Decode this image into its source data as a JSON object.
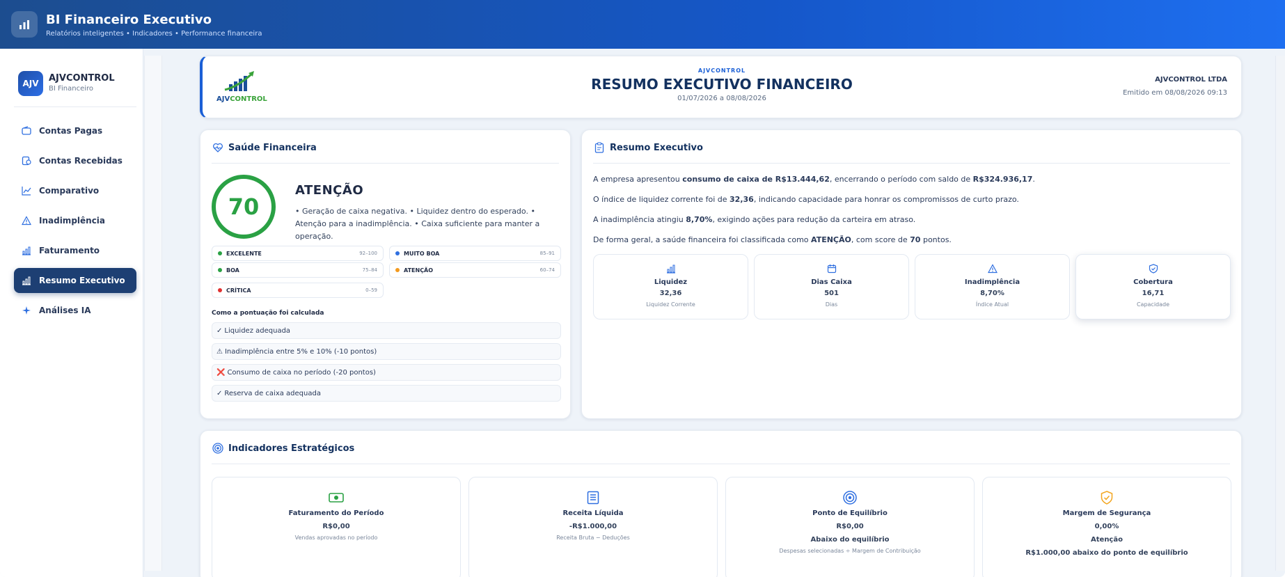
{
  "app": {
    "title": "BI Financeiro Executivo",
    "subtitle": "Relatórios inteligentes • Indicadores • Performance financeira"
  },
  "sidebar": {
    "brand_initials": "AJV",
    "brand_name": "AJVCONTROL",
    "brand_sub": "BI Financeiro",
    "items": [
      {
        "label": "Contas Pagas",
        "icon": "wallet-icon"
      },
      {
        "label": "Contas Recebidas",
        "icon": "receipt-icon"
      },
      {
        "label": "Comparativo",
        "icon": "trend-icon"
      },
      {
        "label": "Inadimplência",
        "icon": "warning-icon"
      },
      {
        "label": "Faturamento",
        "icon": "bar-chart-icon"
      },
      {
        "label": "Resumo Executivo",
        "icon": "bar-chart-icon",
        "active": true
      },
      {
        "label": "Análises IA",
        "icon": "sparkle-icon"
      }
    ]
  },
  "report": {
    "logo_text_a": "AJV",
    "logo_text_b": "CONTROL",
    "brand": "AJVCONTROL",
    "title": "RESUMO EXECUTIVO FINANCEIRO",
    "period": "01/07/2026 a 08/08/2026",
    "company": "AJVCONTROL LTDA",
    "issued": "Emitido em 08/08/2026 09:13"
  },
  "health": {
    "title": "Saúde Financeira",
    "score": "70",
    "status": "ATENÇÃO",
    "description": "• Geração de caixa negativa. • Liquidez dentro do esperado. • Atenção para a inadimplência. • Caixa suficiente para manter a operação.",
    "legend": [
      {
        "label": "EXCELENTE",
        "range": "92–100",
        "color": "#2aa144"
      },
      {
        "label": "MUITO BOA",
        "range": "85–91",
        "color": "#2f6fe0"
      },
      {
        "label": "BOA",
        "range": "75–84",
        "color": "#2aa144"
      },
      {
        "label": "ATENÇÃO",
        "range": "60–74",
        "color": "#f39a1e"
      },
      {
        "label": "CRÍTICA",
        "range": "0–59",
        "color": "#e03131"
      }
    ],
    "calc_title": "Como a pontuação foi calculada",
    "calc_items": [
      {
        "symbol": "✓",
        "text": "Liquidez adequada"
      },
      {
        "symbol": "⚠",
        "text": "Inadimplência entre 5% e 10% (-10 pontos)"
      },
      {
        "symbol": "❌",
        "text": "Consumo de caixa no período (-20 pontos)"
      },
      {
        "symbol": "✓",
        "text": "Reserva de caixa adequada"
      }
    ]
  },
  "exec": {
    "title": "Resumo Executivo",
    "p1a": "A empresa apresentou ",
    "p1b": "consumo de caixa de R$13.444,62",
    "p1c": ", encerrando o período com saldo de ",
    "p1d": "R$324.936,17",
    "p1e": ".",
    "p2a": "O índice de liquidez corrente foi de ",
    "p2b": "32,36",
    "p2c": ", indicando capacidade para honrar os compromissos de curto prazo.",
    "p3a": "A inadimplência atingiu ",
    "p3b": "8,70%",
    "p3c": ", exigindo ações para redução da carteira em atraso.",
    "p4a": "De forma geral, a saúde financeira foi classificada como ",
    "p4b": "ATENÇÃO",
    "p4c": ", com score de ",
    "p4d": "70",
    "p4e": " pontos.",
    "kpis": [
      {
        "label": "Liquidez",
        "value": "32,36",
        "sub": "Liquidez Corrente",
        "icon": "bar-chart-icon"
      },
      {
        "label": "Dias Caixa",
        "value": "501",
        "sub": "Dias",
        "icon": "calendar-icon"
      },
      {
        "label": "Inadimplência",
        "value": "8,70%",
        "sub": "Índice Atual",
        "icon": "warning-icon"
      },
      {
        "label": "Cobertura",
        "value": "16,71",
        "sub": "Capacidade",
        "icon": "shield-icon"
      }
    ]
  },
  "strategic": {
    "title": "Indicadores Estratégicos",
    "cards": [
      {
        "label": "Faturamento do Período",
        "value": "R$0,00",
        "sub": "Vendas aprovadas no período",
        "icon": "money-icon"
      },
      {
        "label": "Receita Líquida",
        "value": "-R$1.000,00",
        "sub": "Receita Bruta − Deduções",
        "icon": "document-icon"
      },
      {
        "label": "Ponto de Equilíbrio",
        "value": "R$0,00",
        "extra": "Abaixo do equilíbrio",
        "sub": "Despesas selecionadas ÷ Margem de Contribuição",
        "icon": "target-icon"
      },
      {
        "label": "Margem de Segurança",
        "value": "0,00%",
        "extra": "Atenção",
        "extra2": "R$1.000,00 abaixo do ponto de equilíbrio",
        "icon": "shield-check-icon"
      }
    ]
  },
  "colors": {
    "header_start": "#1c4d8f",
    "header_end": "#1e6ff0",
    "active_nav": "#1d3f73",
    "score_green": "#2aa144",
    "accent_blue": "#1a5fd6"
  }
}
